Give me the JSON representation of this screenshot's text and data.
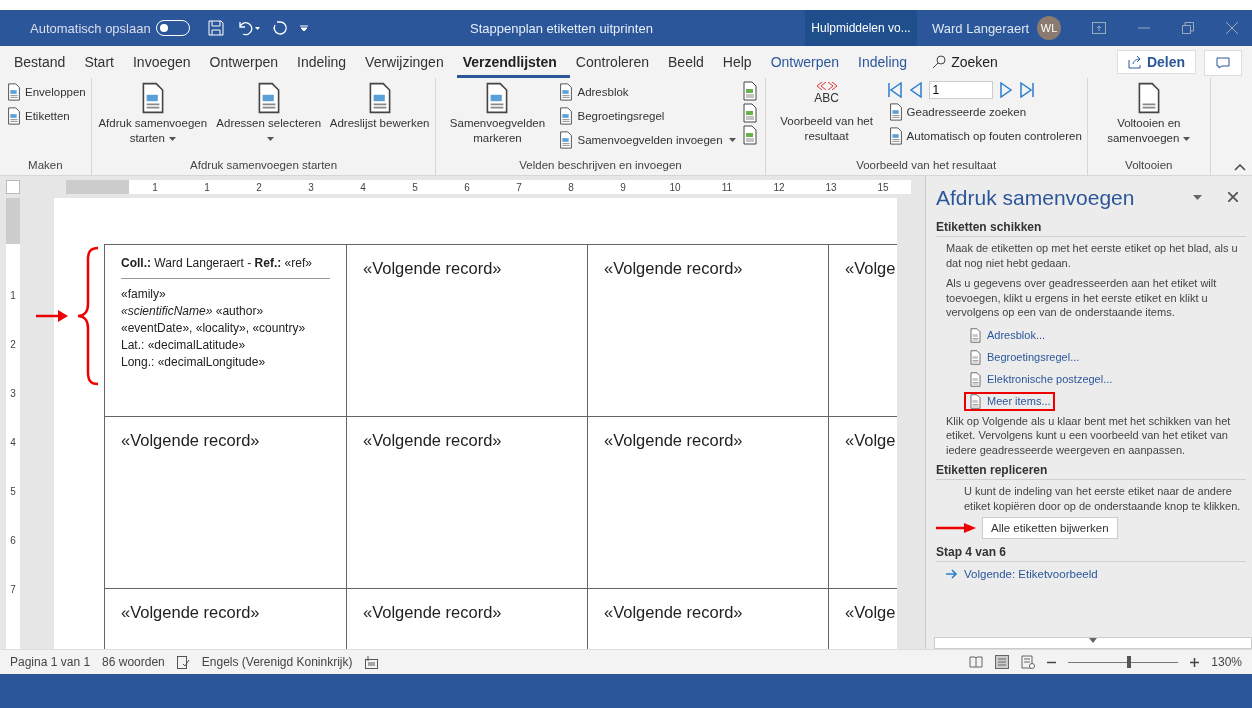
{
  "window": {
    "autosave_label": "Automatisch opslaan",
    "autosave_on": false,
    "title": "Stappenplan etiketten uitprinten",
    "context_tab": "Hulpmiddelen vo...",
    "user_name": "Ward Langeraert",
    "user_initials": "WL"
  },
  "tabs": [
    {
      "label": "Bestand",
      "selected": false,
      "kind": "normal"
    },
    {
      "label": "Start",
      "selected": false,
      "kind": "normal"
    },
    {
      "label": "Invoegen",
      "selected": false,
      "kind": "normal"
    },
    {
      "label": "Ontwerpen",
      "selected": false,
      "kind": "normal"
    },
    {
      "label": "Indeling",
      "selected": false,
      "kind": "normal"
    },
    {
      "label": "Verwijzingen",
      "selected": false,
      "kind": "normal"
    },
    {
      "label": "Verzendlijsten",
      "selected": true,
      "kind": "normal"
    },
    {
      "label": "Controleren",
      "selected": false,
      "kind": "normal"
    },
    {
      "label": "Beeld",
      "selected": false,
      "kind": "normal"
    },
    {
      "label": "Help",
      "selected": false,
      "kind": "normal"
    },
    {
      "label": "Ontwerpen",
      "selected": false,
      "kind": "contextual"
    },
    {
      "label": "Indeling",
      "selected": false,
      "kind": "contextual"
    }
  ],
  "search": "Zoeken",
  "share": "Delen",
  "ribbon": [
    {
      "name": "Maken",
      "columns": [
        {
          "kind": "stack",
          "items": [
            {
              "label": "Enveloppen",
              "dropdown": false
            },
            {
              "label": "Etiketten",
              "dropdown": false
            }
          ]
        }
      ]
    },
    {
      "name": "Afdruk samenvoegen starten",
      "columns": [
        {
          "kind": "large",
          "label": "Afdruk samenvoegen starten",
          "dropdown": true
        },
        {
          "kind": "large",
          "label": "Adressen selecteren",
          "dropdown": true
        },
        {
          "kind": "large",
          "label": "Adreslijst bewerken",
          "dropdown": false
        }
      ]
    },
    {
      "name": "Velden beschrijven en invoegen",
      "columns": [
        {
          "kind": "large",
          "label": "Samenvoegvelden markeren",
          "dropdown": false
        },
        {
          "kind": "stack",
          "items": [
            {
              "label": "Adresblok",
              "dropdown": false
            },
            {
              "label": "Begroetingsregel",
              "dropdown": false
            },
            {
              "label": "Samenvoegvelden invoegen",
              "dropdown": true
            }
          ]
        },
        {
          "kind": "icons"
        }
      ]
    },
    {
      "name": "Voorbeeld van het resultaat",
      "columns": [
        {
          "kind": "preview",
          "badge": "ABC",
          "label": "Voorbeeld van het resultaat"
        },
        {
          "kind": "nav",
          "record": "1",
          "items": [
            {
              "label": "Geadresseerde zoeken",
              "dropdown": false
            },
            {
              "label": "Automatisch op fouten controleren",
              "dropdown": false
            }
          ]
        }
      ]
    },
    {
      "name": "Voltooien",
      "columns": [
        {
          "kind": "large",
          "label": "Voltooien en samenvoegen",
          "dropdown": true
        }
      ]
    }
  ],
  "ruler": [
    "1",
    "1",
    "2",
    "3",
    "4",
    "5",
    "6",
    "7",
    "8",
    "9",
    "10",
    "11",
    "12",
    "13",
    "15"
  ],
  "vruler": [
    "1",
    "2",
    "3",
    "4",
    "5",
    "6",
    "7"
  ],
  "labels": [
    [
      {
        "kind": "label",
        "header": "**Coll.:** Ward Langeraert - **Ref.:** «ref»",
        "lines": [
          "«family»",
          "*«scientificName»* «author»",
          "«eventDate», «locality», «country»",
          "Lat.: «decimalLatitude»",
          "Long.: «decimalLongitude»"
        ]
      },
      {
        "kind": "record",
        "text": "«Volgende record»"
      },
      {
        "kind": "record",
        "text": "«Volgende record»"
      },
      {
        "kind": "record",
        "text": "«Volge"
      }
    ],
    [
      {
        "kind": "record",
        "text": "«Volgende record»"
      },
      {
        "kind": "record",
        "text": "«Volgende record»"
      },
      {
        "kind": "record",
        "text": "«Volgende record»"
      },
      {
        "kind": "record",
        "text": "«Volge"
      }
    ],
    [
      {
        "kind": "record",
        "text": "«Volgende record»"
      },
      {
        "kind": "record",
        "text": "«Volgende record»"
      },
      {
        "kind": "record",
        "text": "«Volgende record»"
      },
      {
        "kind": "record",
        "text": "«Volge"
      }
    ]
  ],
  "pane": {
    "title": "Afdruk samenvoegen",
    "sections": [
      {
        "heading": "Etiketten schikken",
        "blocks": [
          {
            "kind": "text",
            "text": "Maak de etiketten op met het eerste etiket op het blad, als u dat nog niet hebt gedaan."
          },
          {
            "kind": "text",
            "text": "Als u gegevens over geadresseerden aan het etiket wilt toevoegen, klikt u ergens in het eerste etiket en klikt u vervolgens op een van de onderstaande items."
          },
          {
            "kind": "link",
            "label": "Adresblok...",
            "marked": false
          },
          {
            "kind": "link",
            "label": "Begroetingsregel...",
            "marked": false
          },
          {
            "kind": "link",
            "label": "Elektronische postzegel...",
            "marked": false
          },
          {
            "kind": "link",
            "label": "Meer items...",
            "marked": true
          },
          {
            "kind": "text",
            "text": "Klik op Volgende als u klaar bent met het schikken van het etiket. Vervolgens kunt u een voorbeeld van het etiket van iedere geadresseerde weergeven en aanpassen."
          }
        ]
      },
      {
        "heading": "Etiketten repliceren",
        "blocks": [
          {
            "kind": "note",
            "text": "U kunt de indeling van het eerste etiket naar de andere etiket kopiëren door op de onderstaande knop te klikken."
          },
          {
            "kind": "button",
            "label": "Alle etiketten bijwerken",
            "marked": true
          }
        ]
      },
      {
        "heading": "Stap 4 van 6",
        "blocks": [
          {
            "kind": "next",
            "label": "Volgende: Etiketvoorbeeld"
          }
        ]
      }
    ]
  },
  "status": {
    "items": [
      "Pagina 1 van 1",
      "86 woorden"
    ],
    "language": "Engels (Verenigd Koninkrijk)",
    "zoom": {
      "level": 0.55,
      "reading": "130%"
    }
  }
}
